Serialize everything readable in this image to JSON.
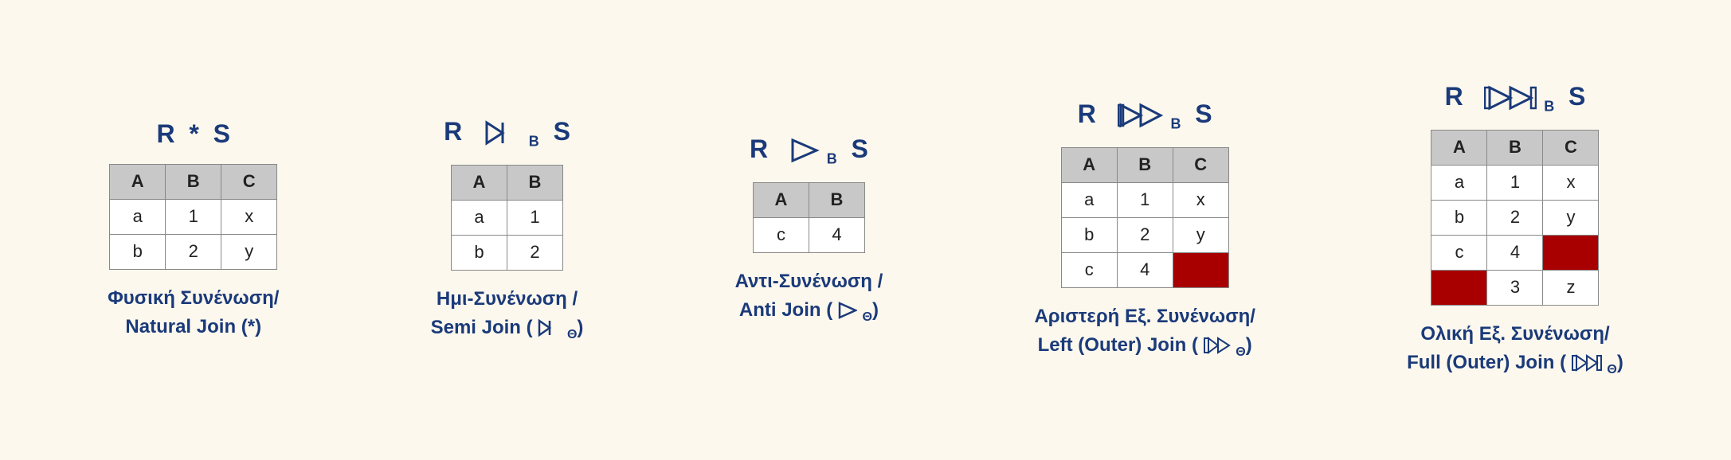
{
  "sections": [
    {
      "id": "natural-join",
      "title_html": "R * S",
      "columns": [
        "A",
        "B",
        "C"
      ],
      "rows": [
        [
          "a",
          "1",
          "x"
        ],
        [
          "b",
          "2",
          "y"
        ]
      ],
      "label_line1": "Φυσική Συνένωση/",
      "label_line2": "Natural Join (*)"
    },
    {
      "id": "semi-join",
      "title_html": "R ⋈<sub>B</sub> S",
      "columns": [
        "A",
        "B"
      ],
      "rows": [
        [
          "a",
          "1"
        ],
        [
          "b",
          "2"
        ]
      ],
      "label_line1": "Ημι-Συνένωση /",
      "label_line2": "Semi Join (⋈<sub>Θ</sub>)"
    },
    {
      "id": "anti-join",
      "title_html": "R ▷<sub>B</sub> S",
      "columns": [
        "A",
        "B"
      ],
      "rows": [
        [
          "c",
          "4"
        ]
      ],
      "label_line1": "Αντι-Συνένωση /",
      "label_line2": "Anti Join ( ▷<sub>Θ</sub>)"
    },
    {
      "id": "left-outer-join",
      "title_html": "R ⟕<sub>B</sub> S",
      "columns": [
        "A",
        "B",
        "C"
      ],
      "rows": [
        [
          "a",
          "1",
          "x",
          false
        ],
        [
          "b",
          "2",
          "y",
          false
        ],
        [
          "c",
          "4",
          "",
          true
        ]
      ],
      "label_line1": "Αριστερή Εξ. Συνένωση/",
      "label_line2": "Left (Outer) Join (⟕<sub>Θ</sub>)"
    },
    {
      "id": "full-outer-join",
      "title_html": "R ⟗<sub>B</sub> S",
      "columns": [
        "A",
        "B",
        "C"
      ],
      "rows": [
        [
          "a",
          "1",
          "x",
          false,
          false,
          false
        ],
        [
          "b",
          "2",
          "y",
          false,
          false,
          false
        ],
        [
          "c",
          "4",
          "",
          false,
          false,
          true
        ],
        [
          "",
          "3",
          "z",
          true,
          false,
          false
        ]
      ],
      "label_line1": "Ολική Εξ. Συνένωση/",
      "label_line2": "Full (Outer) Join (⟗<sub>Θ</sub>)"
    }
  ]
}
